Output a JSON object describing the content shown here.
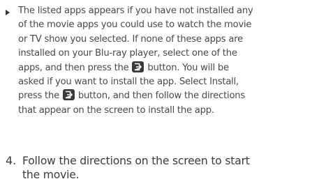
{
  "bullet": {
    "part1": "The listed apps appears if you have not installed any\nof the movie apps you could use to watch the movie\nor TV show you selected. If none of these apps are\ninstalled on your Blu-ray player, select one of the\napps, and then press the ",
    "part2": " button. You will be\nasked if you want to install the app. Select Install,\npress the ",
    "part3": " button, and then follow the directions\nthat appear on the screen to install the app."
  },
  "step": {
    "number": "4.",
    "text": "Follow the directions on the screen to start\nthe movie."
  },
  "icons": {
    "bullet": "right-triangle-bullet",
    "enter_button": "enter-button-icon"
  },
  "colors": {
    "text": "#4a4a4a",
    "icon_bg": "#3a3a3a"
  }
}
